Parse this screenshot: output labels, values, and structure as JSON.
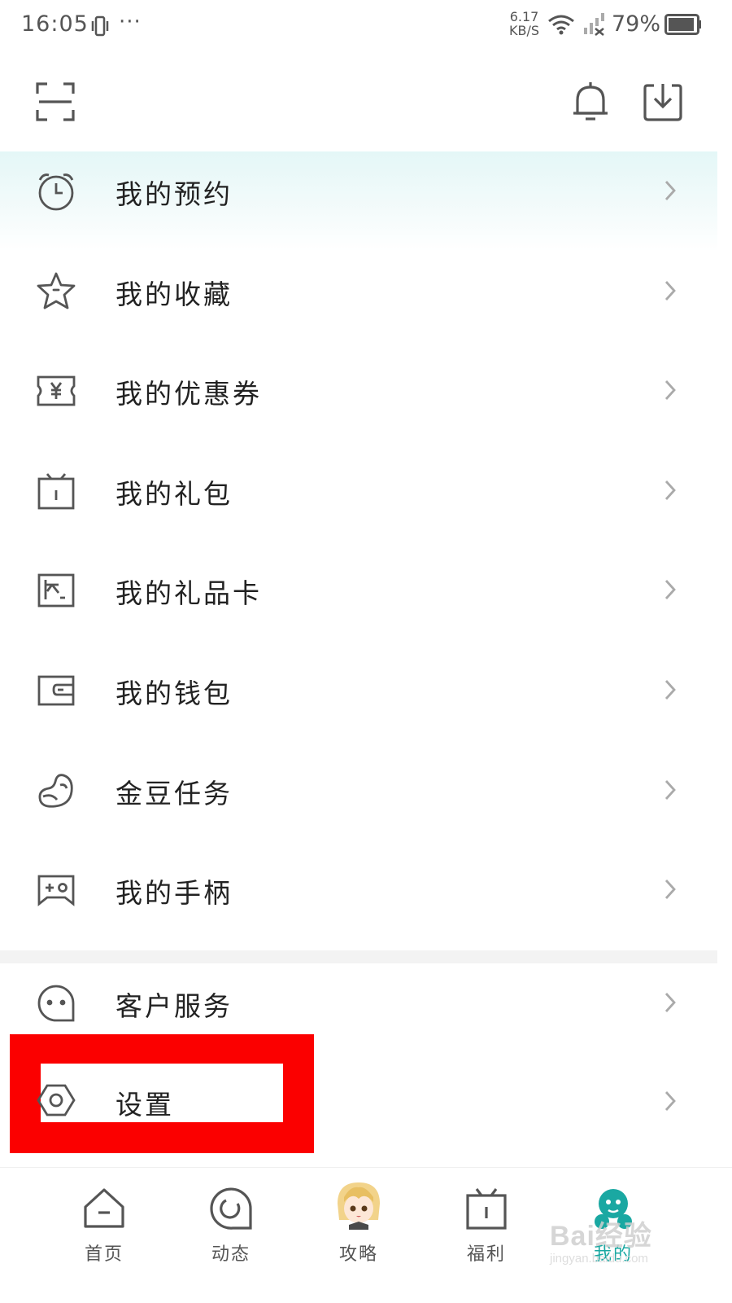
{
  "status_bar": {
    "time": "16:05",
    "dots": "···",
    "speed_value": "6.17",
    "speed_unit": "KB/S",
    "battery": "79%"
  },
  "toolbar": {
    "scan_icon": "scan-icon",
    "bell_icon": "bell-icon",
    "download_icon": "download-icon"
  },
  "menu": {
    "group1": [
      {
        "label": "我的预约",
        "icon": "alarm-clock-icon"
      },
      {
        "label": "我的收藏",
        "icon": "star-icon"
      },
      {
        "label": "我的优惠券",
        "icon": "coupon-icon"
      },
      {
        "label": "我的礼包",
        "icon": "gift-box-icon"
      },
      {
        "label": "我的礼品卡",
        "icon": "gift-card-icon"
      },
      {
        "label": "我的钱包",
        "icon": "wallet-icon"
      },
      {
        "label": "金豆任务",
        "icon": "bean-icon"
      },
      {
        "label": "我的手柄",
        "icon": "gamepad-icon"
      }
    ],
    "group2": [
      {
        "label": "客户服务",
        "icon": "customer-service-icon"
      },
      {
        "label": "设置",
        "icon": "settings-icon"
      }
    ]
  },
  "bottom_nav": [
    {
      "label": "首页",
      "icon": "home-icon"
    },
    {
      "label": "动态",
      "icon": "feed-icon"
    },
    {
      "label": "攻略",
      "icon": "anime-avatar-icon"
    },
    {
      "label": "福利",
      "icon": "gift-icon"
    },
    {
      "label": "我的",
      "icon": "profile-icon",
      "active": true
    }
  ],
  "watermark": {
    "logo": "Bai经验",
    "sub": "jingyan.baidu.com"
  },
  "colors": {
    "accent": "#1aa8a2",
    "highlight_bg": "#e4f7f7",
    "annotation_red": "#fb0000",
    "icon_gray": "#555555"
  }
}
